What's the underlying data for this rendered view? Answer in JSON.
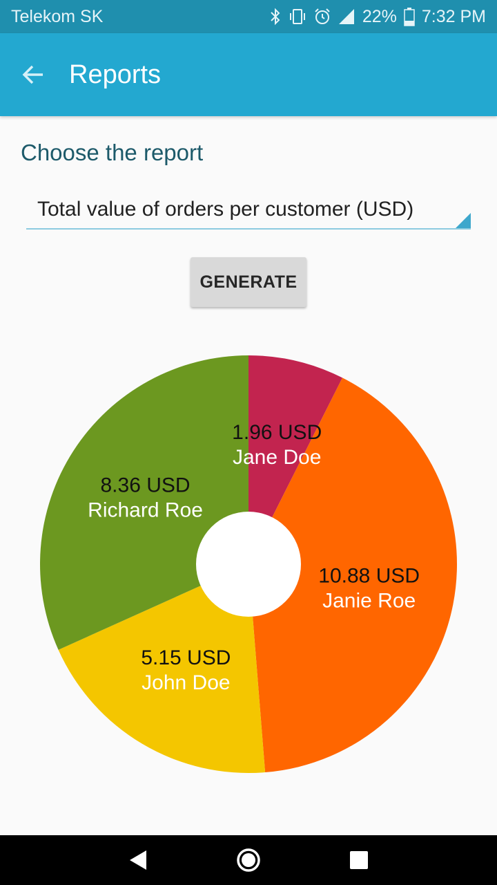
{
  "status": {
    "carrier": "Telekom SK",
    "battery": "22%",
    "time": "7:32 PM"
  },
  "appbar": {
    "title": "Reports"
  },
  "form": {
    "label": "Choose the report",
    "selected_report": "Total value of orders per customer (USD)",
    "generate_label": "GENERATE"
  },
  "chart_data": {
    "type": "pie",
    "unit": "USD",
    "slices": [
      {
        "label": "Jane  Doe",
        "value": 1.96,
        "value_label": "1.96 USD",
        "color": "#c2244f"
      },
      {
        "label": "Janie  Roe",
        "value": 10.88,
        "value_label": "10.88 USD",
        "color": "#ff6600"
      },
      {
        "label": "John  Doe",
        "value": 5.15,
        "value_label": "5.15 USD",
        "color": "#f4c600"
      },
      {
        "label": "Richard  Roe",
        "value": 8.36,
        "value_label": "8.36 USD",
        "color": "#6c9820"
      }
    ]
  }
}
